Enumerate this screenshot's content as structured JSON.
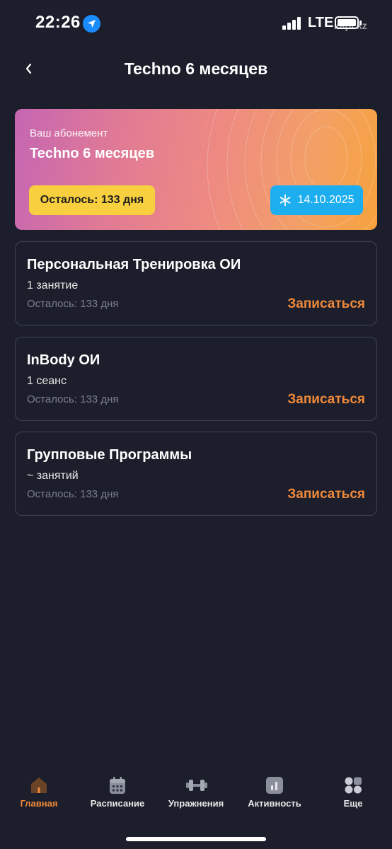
{
  "status_bar": {
    "time": "22:26",
    "network": "LTE",
    "watermark": "kapi.kz"
  },
  "header": {
    "title": "Techno 6 месяцев"
  },
  "subscription": {
    "label": "Ваш абонемент",
    "name": "Techno 6 месяцев",
    "remaining": "Осталось: 133 дня",
    "freeze_date": "14.10.2025"
  },
  "services": [
    {
      "title": "Персональная Тренировка ОИ",
      "sessions": "1 занятие",
      "remaining": "Осталось: 133 дня",
      "action": "Записаться"
    },
    {
      "title": "InBody ОИ",
      "sessions": "1 сеанс",
      "remaining": "Осталось: 133 дня",
      "action": "Записаться"
    },
    {
      "title": "Групповые Программы",
      "sessions": "~ занятий",
      "remaining": "Осталось: 133 дня",
      "action": "Записаться"
    }
  ],
  "nav": [
    {
      "label": "Главная",
      "icon": "home-icon",
      "active": true
    },
    {
      "label": "Расписание",
      "icon": "calendar-icon",
      "active": false
    },
    {
      "label": "Упражнения",
      "icon": "dumbbell-icon",
      "active": false
    },
    {
      "label": "Активность",
      "icon": "chart-icon",
      "active": false
    },
    {
      "label": "Еще",
      "icon": "grid-icon",
      "active": false
    }
  ],
  "colors": {
    "background": "#1c1f2b",
    "accent": "#f0893a",
    "remaining_badge": "#f7cf3f",
    "freeze_badge": "#1daef0"
  }
}
